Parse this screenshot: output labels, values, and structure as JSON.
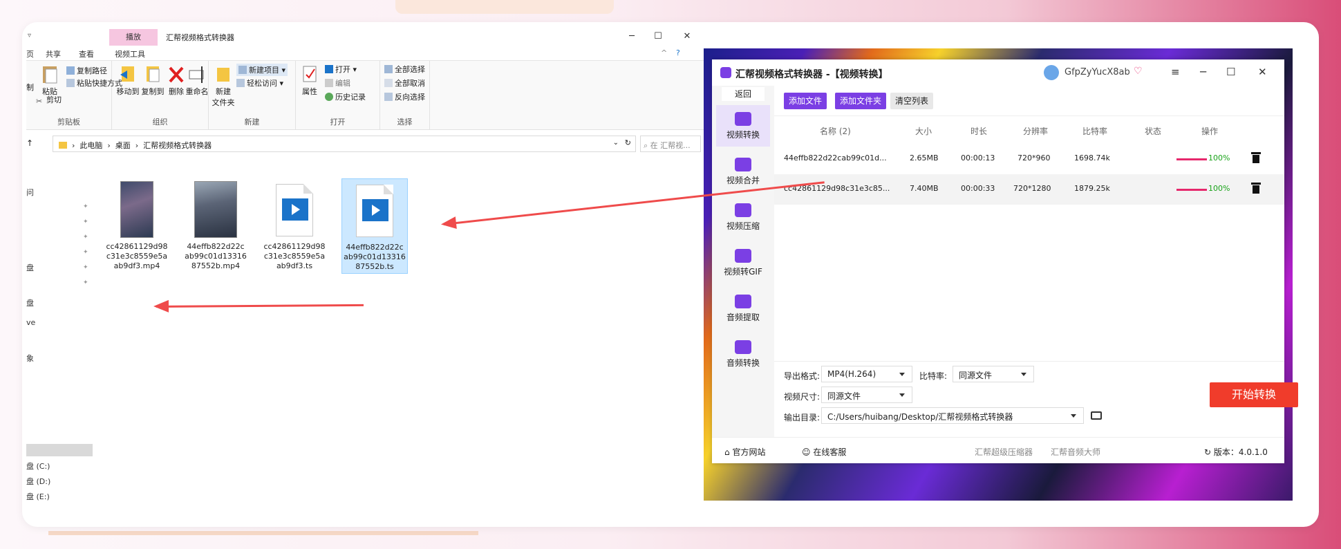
{
  "explorer": {
    "title": "汇帮视频格式转换器",
    "context_tab": "播放",
    "tabs": [
      "页",
      "共享",
      "查看",
      "视频工具"
    ],
    "ribbon": {
      "clipboard": {
        "paste": "粘贴",
        "copy_path": "复制路径",
        "paste_shortcut": "粘贴快捷方式",
        "cut": "剪切",
        "label": "剪贴板",
        "left_fragment": "制"
      },
      "organize": {
        "move_to": "移动到",
        "copy_to": "复制到",
        "delete": "删除",
        "rename": "重命名",
        "label": "组织"
      },
      "new": {
        "new_folder": "新建\n文件夹",
        "new_item": "新建项目",
        "easy_access": "轻松访问",
        "label": "新建"
      },
      "open": {
        "properties": "属性",
        "open": "打开",
        "edit": "编辑",
        "history": "历史记录",
        "label": "打开"
      },
      "select": {
        "select_all": "全部选择",
        "select_none": "全部取消",
        "invert": "反向选择",
        "label": "选择"
      }
    },
    "address": {
      "crumbs": [
        "此电脑",
        "桌面",
        "汇帮视频格式转换器"
      ],
      "search_placeholder": "在 汇帮视..."
    },
    "nav_fragments": [
      "问",
      "盘",
      "盘",
      "ve",
      "象",
      "盘 (C:)",
      "盘 (D:)",
      "盘 (E:)"
    ],
    "files": [
      {
        "name": "cc42861129d98c31e3c8559e5aab9df3.mp4",
        "line1": "cc42861129d98",
        "line2": "c31e3c8559e5a",
        "line3": "ab9df3.mp4"
      },
      {
        "name": "44effb822d22cab99c01d1331687552b.mp4",
        "line1": "44effb822d22c",
        "line2": "ab99c01d13316",
        "line3": "87552b.mp4"
      },
      {
        "name": "cc42861129d98c31e3c8559e5aab9df3.ts",
        "line1": "cc42861129d98",
        "line2": "c31e3c8559e5a",
        "line3": "ab9df3.ts"
      },
      {
        "name": "44effb822d22cab99c01d1331687552b.ts",
        "line1": "44effb822d22c",
        "line2": "ab99c01d13316",
        "line3": "87552b.ts"
      }
    ]
  },
  "converter": {
    "app_name": "汇帮视频格式转换器",
    "mode": "-【视频转换】",
    "username": "GfpZyYucX8ab",
    "back": "返回",
    "sidebar": [
      "视频转换",
      "视频合并",
      "视频压缩",
      "视频转GIF",
      "音频提取",
      "音频转换"
    ],
    "toolbar": {
      "add_file": "添加文件",
      "add_folder": "添加文件夹",
      "clear": "清空列表"
    },
    "columns": [
      "名称 (2)",
      "大小",
      "时长",
      "分辨率",
      "比特率",
      "状态",
      "操作"
    ],
    "rows": [
      {
        "name": "44effb822d22cab99c01d...",
        "size": "2.65MB",
        "duration": "00:00:13",
        "resolution": "720*960",
        "bitrate": "1698.74k",
        "status": "100%"
      },
      {
        "name": "cc42861129d98c31e3c85...",
        "size": "7.40MB",
        "duration": "00:00:33",
        "resolution": "720*1280",
        "bitrate": "1879.25k",
        "status": "100%"
      }
    ],
    "settings": {
      "format_label": "导出格式:",
      "format_value": "MP4(H.264)",
      "bitrate_label": "比特率:",
      "bitrate_value": "同源文件",
      "size_label": "视频尺寸:",
      "size_value": "同源文件",
      "output_label": "输出目录:",
      "output_value": "C:/Users/huibang/Desktop/汇帮视频格式转换器"
    },
    "start_button": "开始转换",
    "footer": {
      "website": "官方网站",
      "support": "在线客服",
      "link1": "汇帮超级压缩器",
      "link2": "汇帮音频大师",
      "version": "版本：4.0.1.0"
    }
  },
  "colors": {
    "accent": "#7b3fe4",
    "start": "#f03c2b",
    "arrow": "#ef4b4b",
    "progress": "#e6286c"
  }
}
